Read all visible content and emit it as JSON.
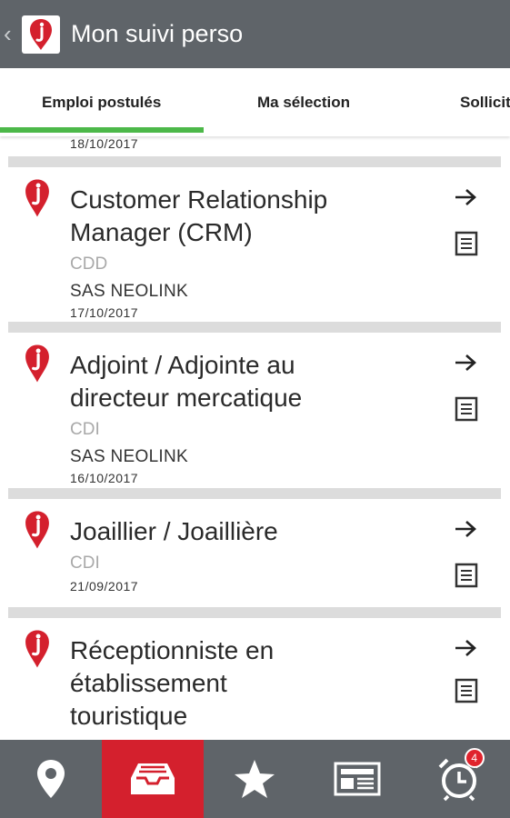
{
  "header": {
    "back_glyph": "‹",
    "title": "Mon suivi perso"
  },
  "tabs": [
    {
      "label": "Emploi postulés",
      "active": true
    },
    {
      "label": "Ma sélection",
      "active": false
    },
    {
      "label": "Sollicit",
      "active": false
    }
  ],
  "colors": {
    "accent_green": "#4cb849",
    "brand_red": "#d4202d",
    "bar_grey": "#5f6469"
  },
  "list": {
    "peek_date": "18/10/2017",
    "items": [
      {
        "title": "Customer Relationship Manager (CRM)",
        "contract": "CDD",
        "company": "SAS NEOLINK",
        "date": "17/10/2017"
      },
      {
        "title": "Adjoint / Adjointe au directeur mercatique",
        "contract": "CDI",
        "company": "SAS NEOLINK",
        "date": "16/10/2017"
      },
      {
        "title": "Joaillier / Joaillière",
        "contract": "CDI",
        "company": "",
        "date": "21/09/2017"
      },
      {
        "title": "Réceptionniste en établissement touristique",
        "contract": "",
        "company": "",
        "date": ""
      }
    ]
  },
  "bottom_nav": {
    "items": [
      {
        "icon": "map-pin-icon"
      },
      {
        "icon": "inbox-icon",
        "active": true
      },
      {
        "icon": "star-icon"
      },
      {
        "icon": "newspaper-icon"
      },
      {
        "icon": "alarm-clock-icon",
        "badge": "4"
      }
    ]
  }
}
